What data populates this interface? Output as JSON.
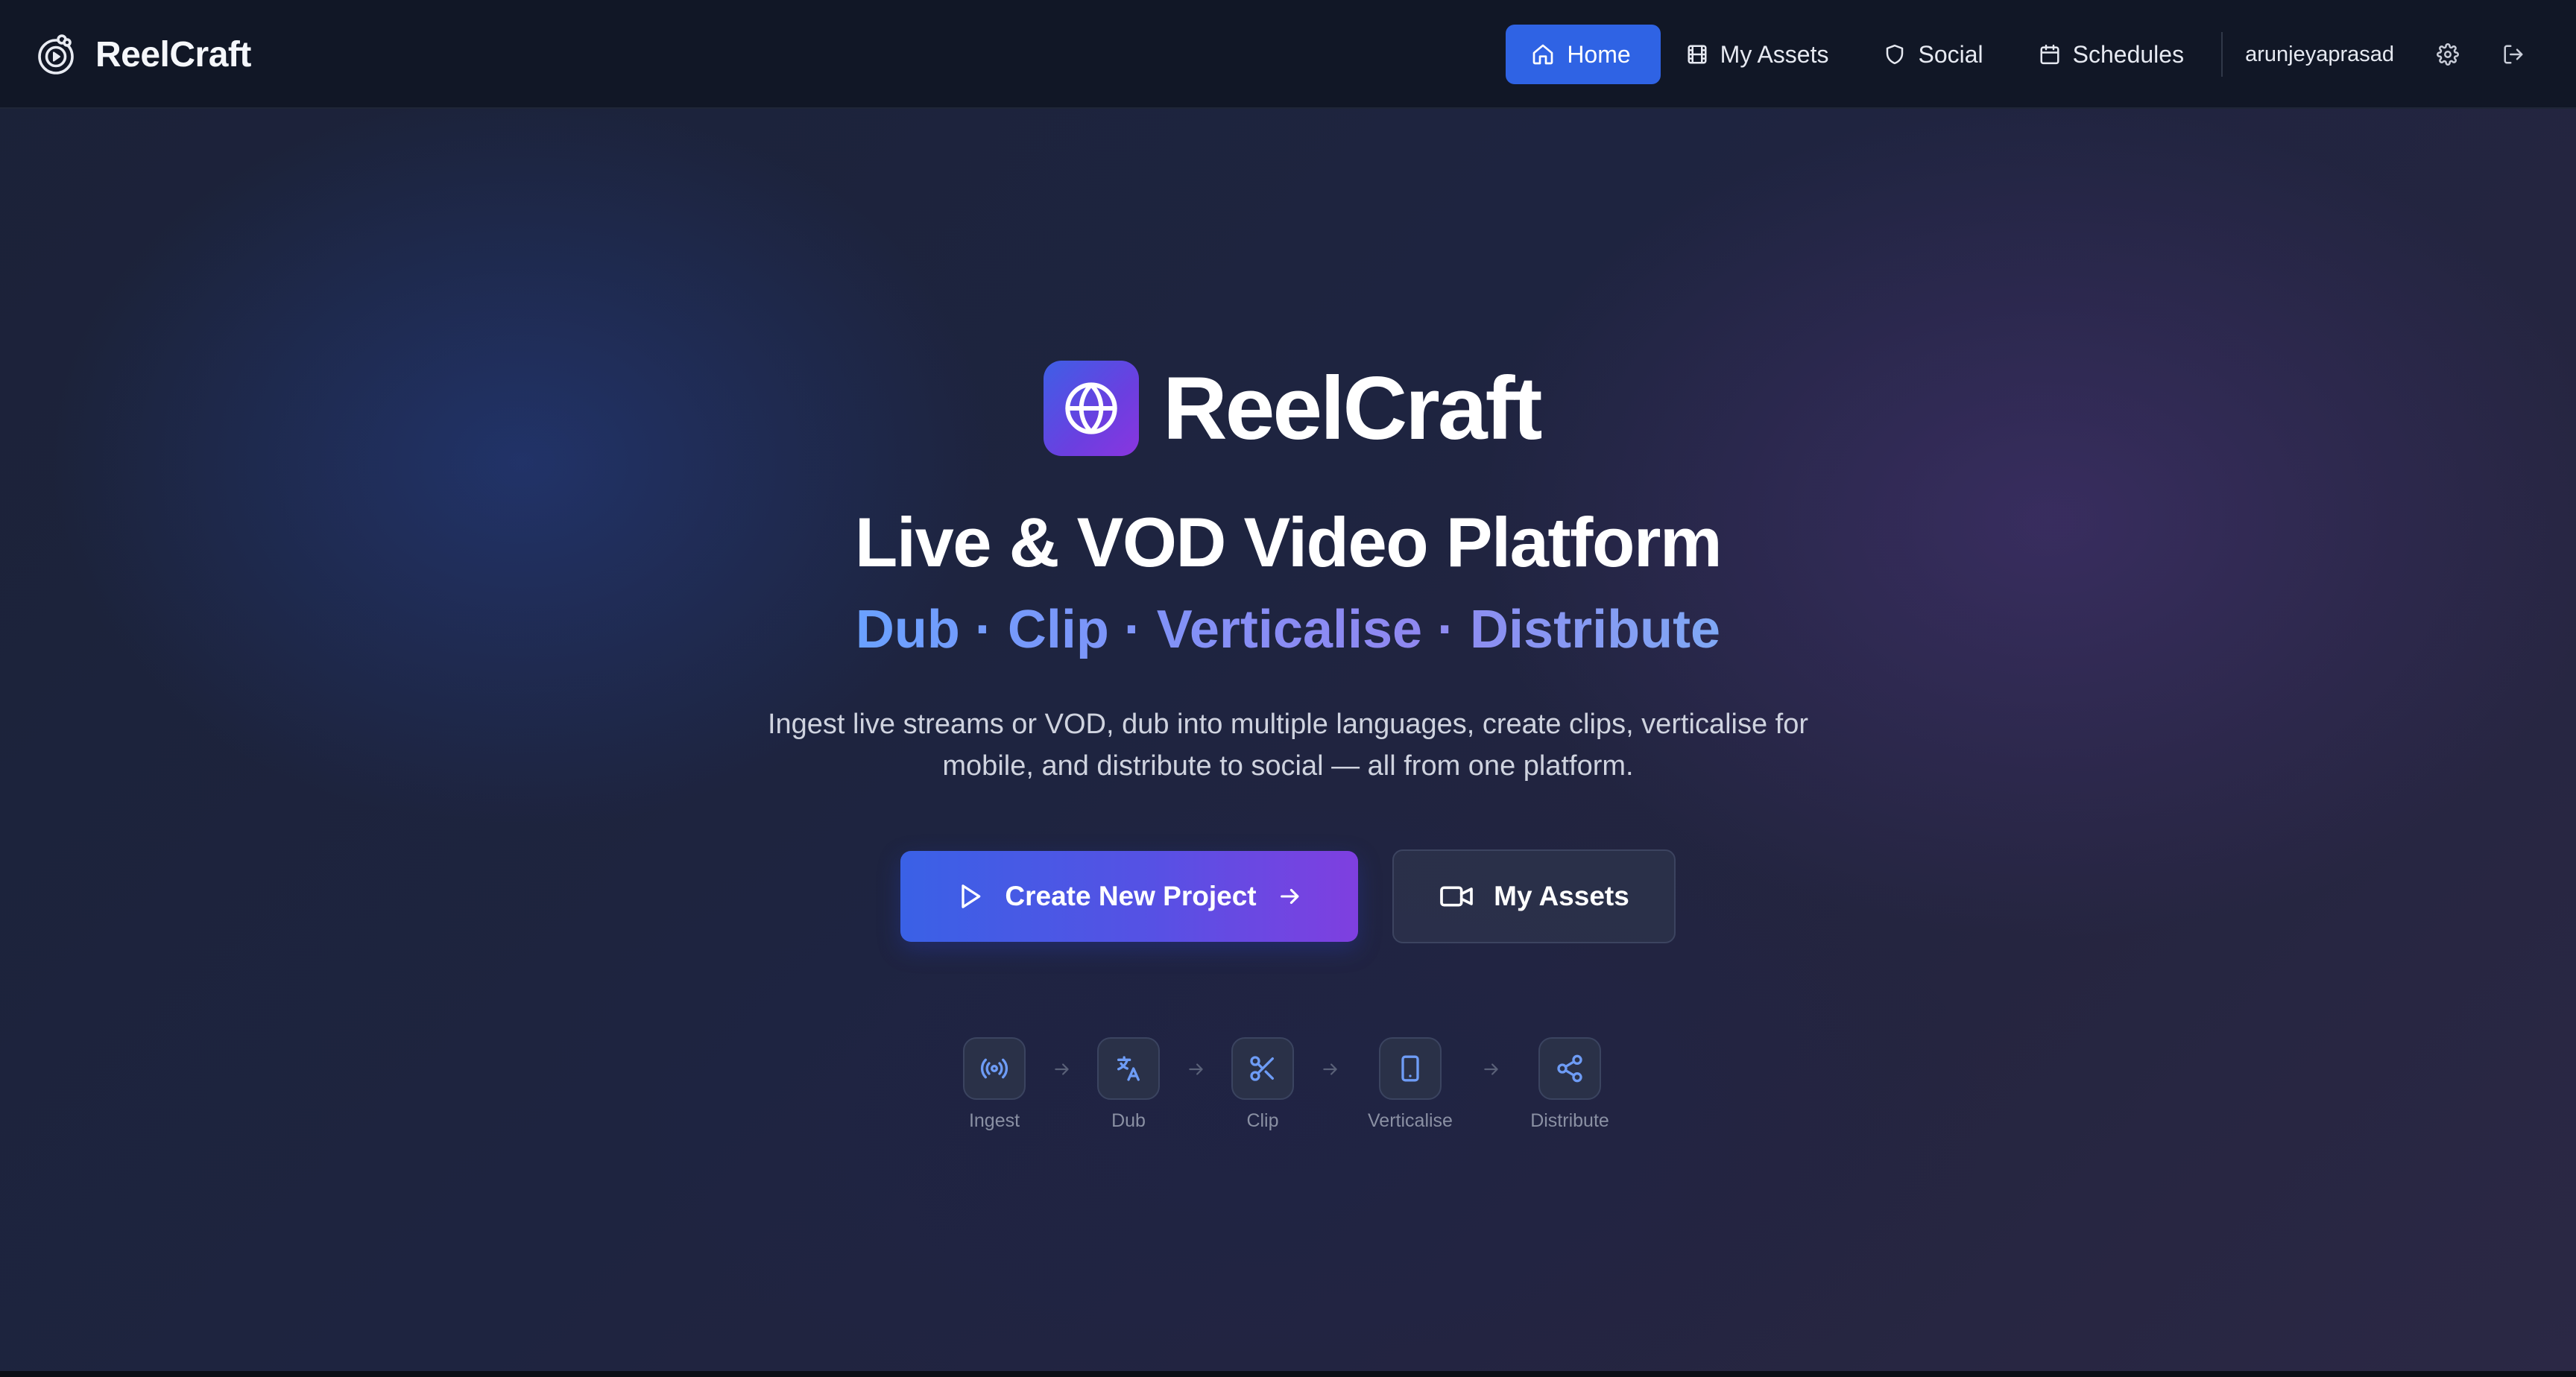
{
  "app": {
    "name": "ReelCraft"
  },
  "nav": {
    "items": [
      {
        "label": "Home",
        "icon": "home-icon",
        "active": true
      },
      {
        "label": "My Assets",
        "icon": "film-icon",
        "active": false
      },
      {
        "label": "Social",
        "icon": "shield-icon",
        "active": false
      },
      {
        "label": "Schedules",
        "icon": "calendar-icon",
        "active": false
      }
    ],
    "username": "arunjeyaprasad",
    "settings_icon": "gear-icon",
    "logout_icon": "logout-icon",
    "active_color": "#2f63e4"
  },
  "hero": {
    "logo_icon": "globe-icon",
    "title": "ReelCraft",
    "headline": "Live & VOD Video Platform",
    "tagline": "Dub · Clip · Verticalise · Distribute",
    "description": "Ingest live streams or VOD, dub into multiple languages, create clips, verticalise for mobile, and distribute to social — all from one platform.",
    "primary_button": {
      "label": "Create New Project",
      "icon": "play-icon",
      "trailing_icon": "arrow-right-icon"
    },
    "secondary_button": {
      "label": "My Assets",
      "icon": "video-camera-icon"
    }
  },
  "pipeline": {
    "steps": [
      {
        "label": "Ingest",
        "icon": "broadcast-icon"
      },
      {
        "label": "Dub",
        "icon": "translate-icon"
      },
      {
        "label": "Clip",
        "icon": "scissors-icon"
      },
      {
        "label": "Verticalise",
        "icon": "smartphone-icon"
      },
      {
        "label": "Distribute",
        "icon": "share-icon"
      }
    ]
  },
  "colors": {
    "accent": "#2f63e4",
    "gradient_start": "#3a61e6",
    "gradient_end": "#7f3fe0",
    "step_icon": "#6e9cf6"
  }
}
